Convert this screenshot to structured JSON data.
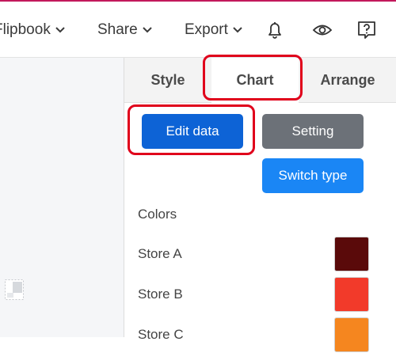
{
  "topbar": {
    "menus": [
      {
        "label": "Flipbook"
      },
      {
        "label": "Share"
      },
      {
        "label": "Export"
      }
    ]
  },
  "panel": {
    "tabs": [
      {
        "label": "Style",
        "active": false
      },
      {
        "label": "Chart",
        "active": true
      },
      {
        "label": "Arrange",
        "active": false
      }
    ],
    "buttons": {
      "edit_data": "Edit data",
      "setting": "Setting",
      "switch_type": "Switch type"
    },
    "colors_label": "Colors",
    "colors": [
      {
        "label": "Store A",
        "color": "#5a0a0a"
      },
      {
        "label": "Store B",
        "color": "#f23a2a"
      },
      {
        "label": "Store C",
        "color": "#f5861f"
      }
    ]
  },
  "theme": {
    "accent": "#c2185b",
    "primary_button": "#0d63d6",
    "secondary_button": "#6c7178",
    "switch_button": "#1a86f5",
    "highlight": "#e0001b"
  }
}
